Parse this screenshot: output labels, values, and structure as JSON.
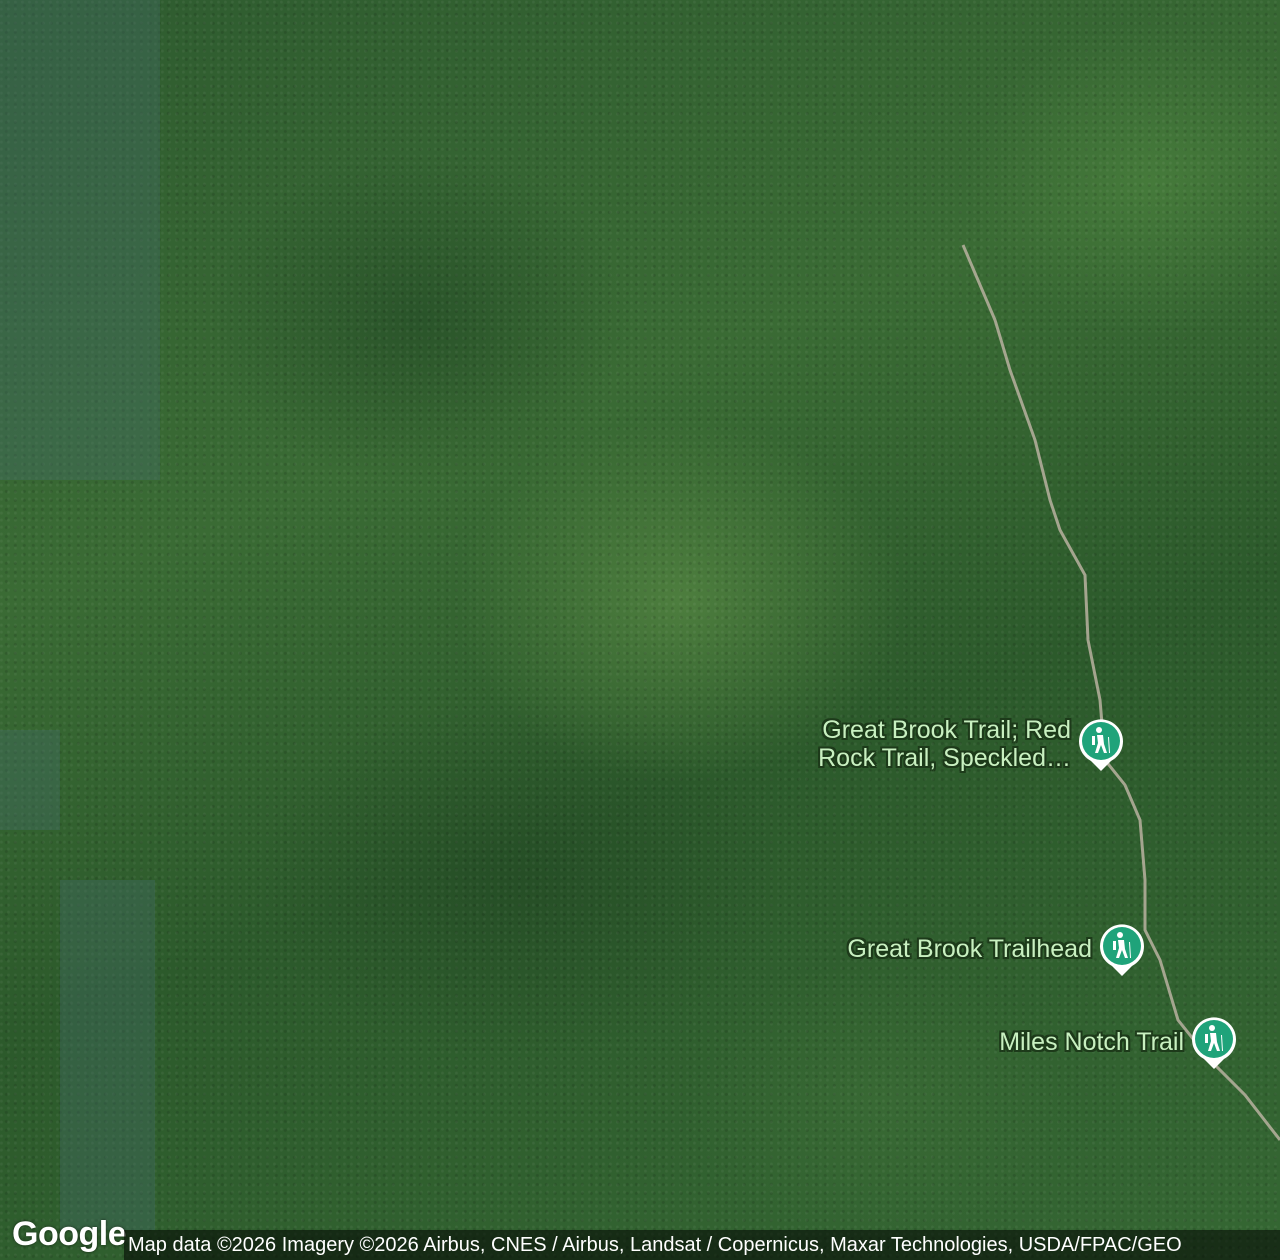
{
  "map": {
    "type": "satellite",
    "markers": [
      {
        "label": "Great Brook Trail; Red Rock Trail, Speckled…",
        "icon": "hiker-icon"
      },
      {
        "label": "Great Brook Trailhead",
        "icon": "hiker-icon"
      },
      {
        "label": "Miles Notch Trail",
        "icon": "hiker-icon"
      }
    ],
    "marker_color": "#1fa37a"
  },
  "footer": {
    "logo": "Google",
    "attribution": "Map data ©2026 Imagery ©2026 Airbus, CNES / Airbus, Landsat / Copernicus, Maxar Technologies, USDA/FPAC/GEO"
  }
}
